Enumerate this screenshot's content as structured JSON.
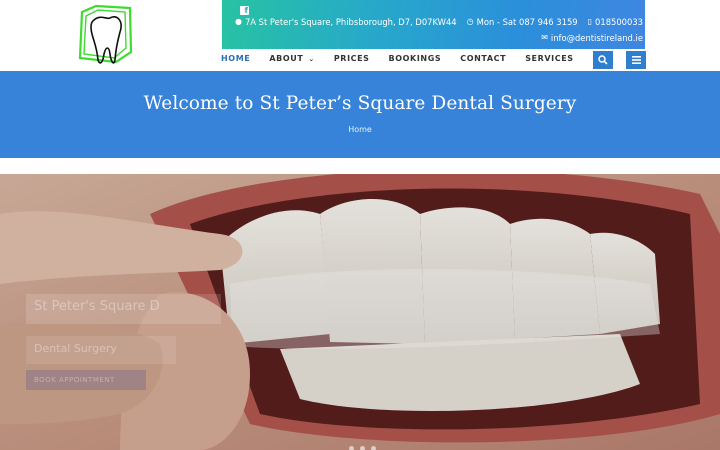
{
  "header": {
    "social_icon": "facebook-icon",
    "address": "7A St Peter's Square, Phibsborough, D7, D07KW44",
    "hours": "Mon - Sat 087 946 3159",
    "phone": "018500033",
    "email": "info@dentistireland.ie"
  },
  "nav": {
    "items": [
      {
        "label": "HOME",
        "active": true
      },
      {
        "label": "ABOUT",
        "has_dropdown": true
      },
      {
        "label": "PRICES"
      },
      {
        "label": "BOOKINGS"
      },
      {
        "label": "CONTACT"
      },
      {
        "label": "SERVICES"
      }
    ],
    "search_icon": "search-icon",
    "menu_icon": "hamburger-menu-icon"
  },
  "band": {
    "title": "Welcome to St Peter’s Square Dental Surgery",
    "breadcrumb": "Home"
  },
  "hero": {
    "slide_title": "St Peter's Square D",
    "slide_subtitle": "Dental Surgery",
    "slide_button": "BOOK APPOINTMENT"
  },
  "colors": {
    "brand_blue": "#3683d9",
    "topbar_start": "#27c3a2",
    "topbar_end": "#3f86e1",
    "logo_green": "#3ddc2f"
  }
}
